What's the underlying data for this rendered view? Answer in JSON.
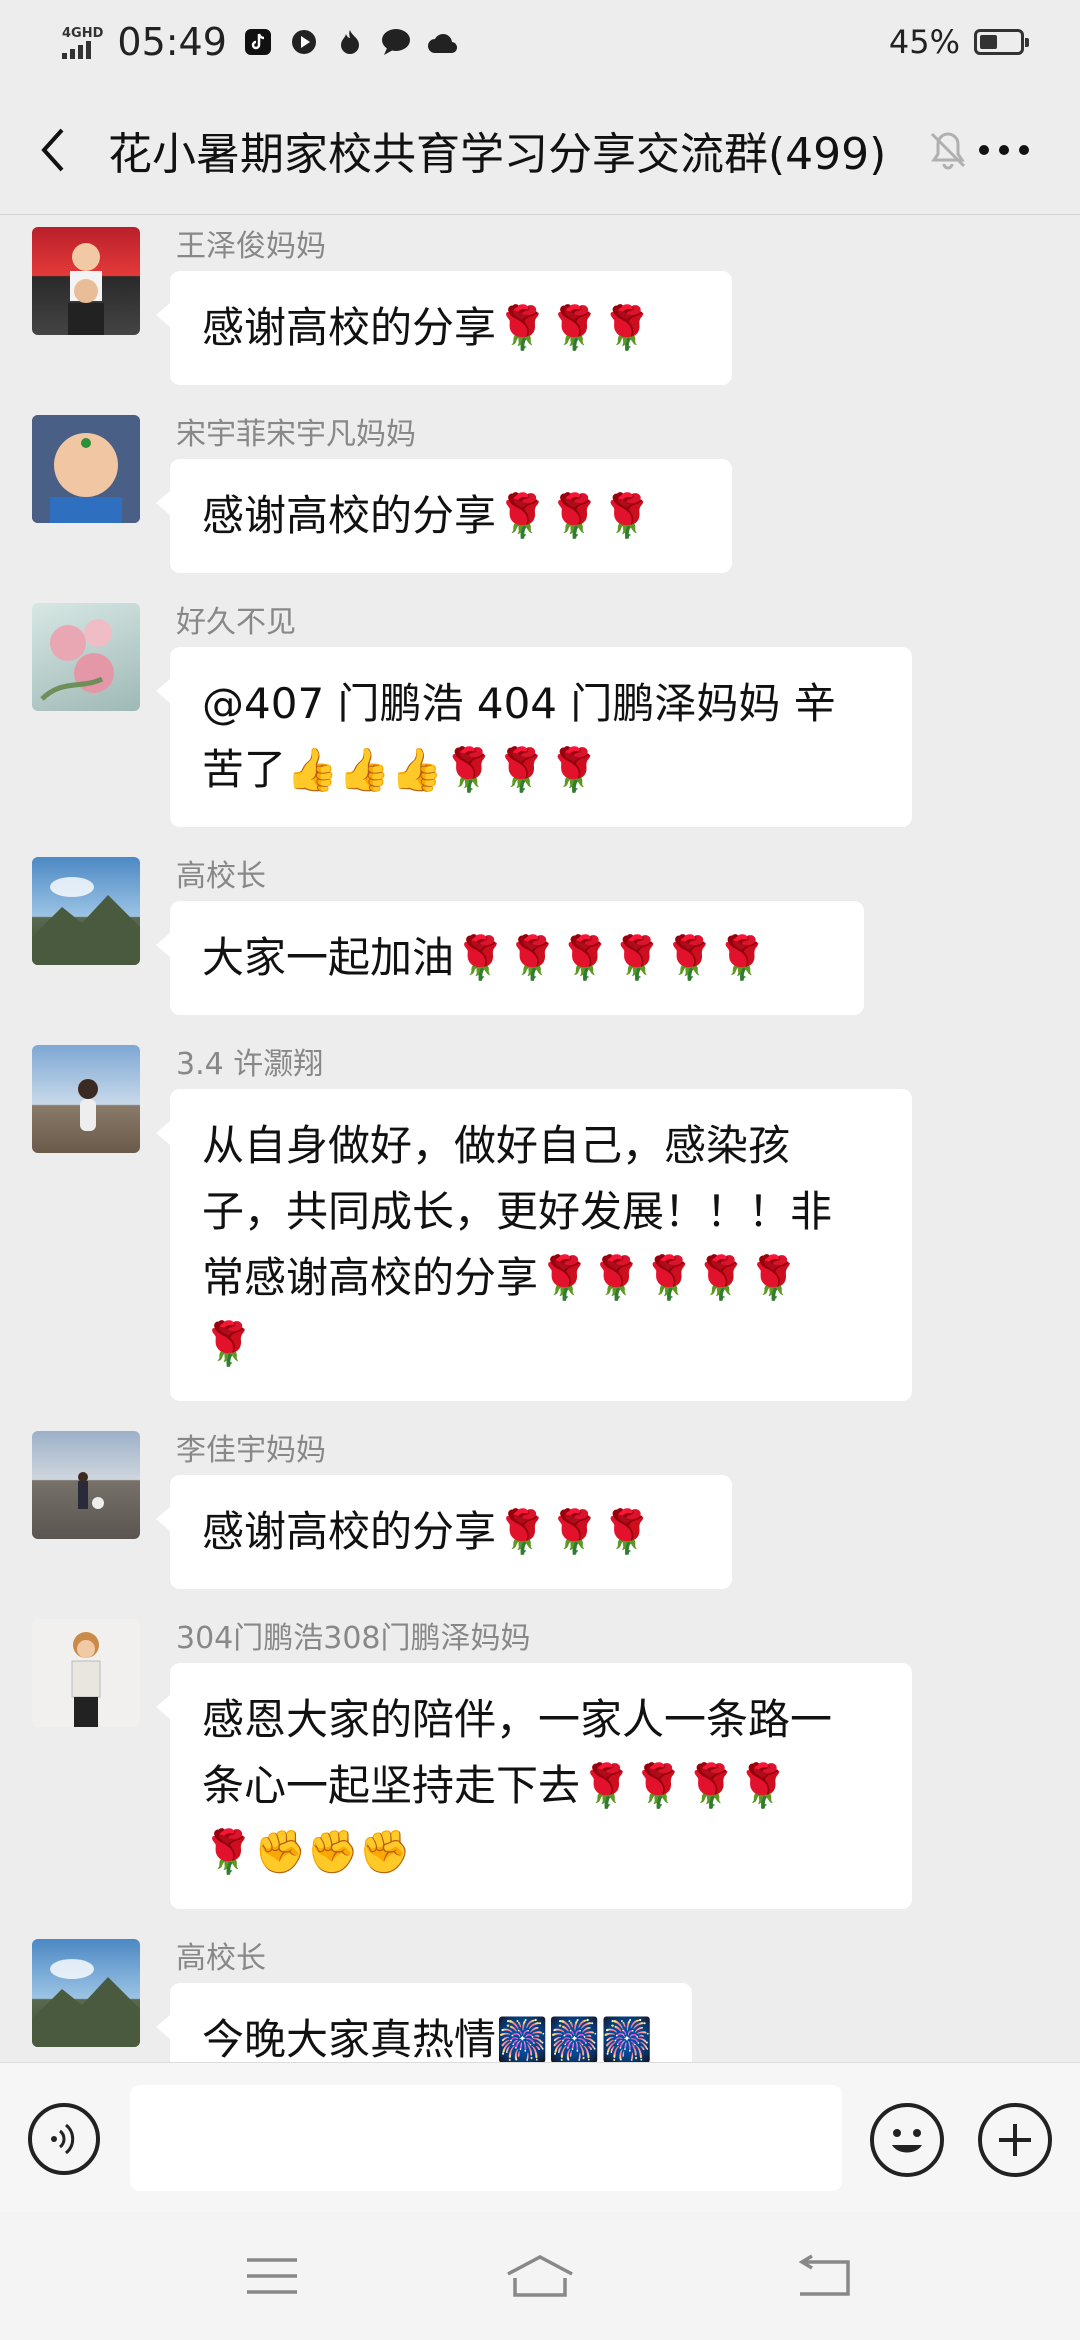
{
  "status_bar": {
    "network": "4GHD",
    "time": "05:49",
    "battery": "45%",
    "battery_level": 0.45,
    "icons": [
      "tiktok-icon",
      "play-icon",
      "flame-icon",
      "chat-bubble-icon",
      "cloud-icon"
    ]
  },
  "header": {
    "title": "花小暑期家校共育学习分享交流群(499)",
    "back_icon": "chevron-left-icon",
    "mute_icon": "bell-off-icon",
    "more_icon": "more-dots-icon"
  },
  "messages": [
    {
      "sender": "王泽俊妈妈",
      "lines": [
        "感谢高校的分享🌹🌹🌹"
      ]
    },
    {
      "sender": "宋宇菲宋宇凡妈妈",
      "lines": [
        "感谢高校的分享🌹🌹🌹"
      ]
    },
    {
      "sender": "好久不见",
      "lines": [
        "@407 门鹏浩 404 门鹏泽妈妈  辛",
        "苦了👍👍👍🌹🌹🌹"
      ]
    },
    {
      "sender": "高校长",
      "lines": [
        "大家一起加油🌹🌹🌹🌹🌹🌹"
      ]
    },
    {
      "sender": "3.4 许灏翔",
      "lines": [
        "从自身做好，做好自己，感染孩",
        "子，共同成长，更好发展！！！非",
        "常感谢高校的分享🌹🌹🌹🌹🌹",
        "🌹"
      ]
    },
    {
      "sender": "李佳宇妈妈",
      "lines": [
        "感谢高校的分享🌹🌹🌹"
      ]
    },
    {
      "sender": "304门鹏浩308门鹏泽妈妈",
      "lines": [
        "感恩大家的陪伴，一家人一条路一",
        "条心一起坚持走下去🌹🌹🌹🌹",
        "🌹✊✊✊"
      ]
    },
    {
      "sender": "高校长",
      "lines": [
        "今晚大家真热情🎆🎆🎆"
      ]
    }
  ],
  "input_bar": {
    "voice_icon": "voice-icon",
    "placeholder": "",
    "emoji_icon": "smiley-icon",
    "plus_icon": "plus-icon"
  },
  "nav_bar": {
    "icons": [
      "menu-icon",
      "home-icon",
      "back-icon"
    ]
  }
}
